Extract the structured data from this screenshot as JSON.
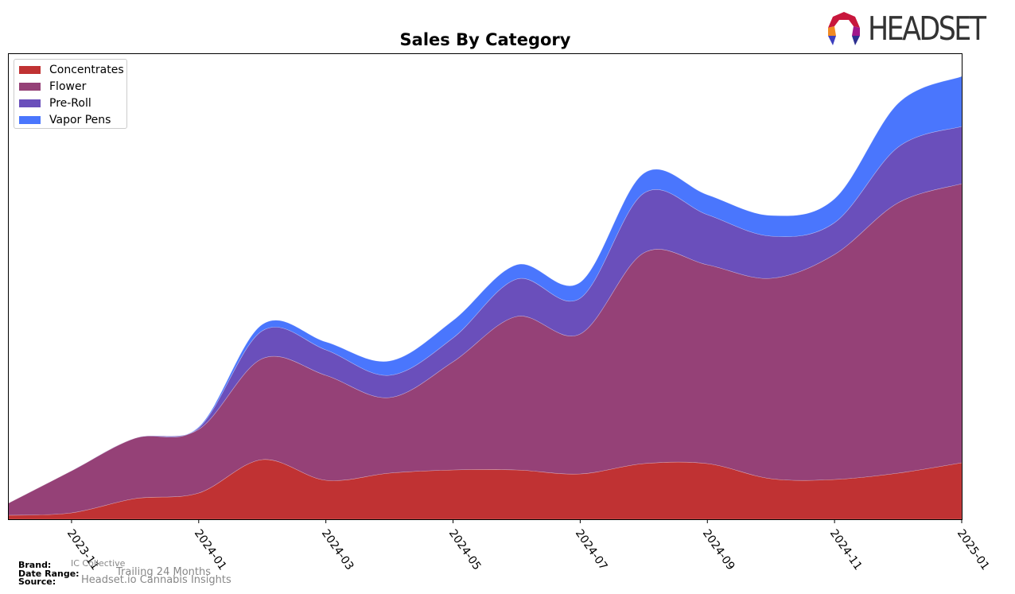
{
  "logo": {
    "text": "HEADSET",
    "icon": "headset-logo-icon"
  },
  "chart_data": {
    "type": "area",
    "stacked": true,
    "smoothed": true,
    "title": "Sales By Category",
    "xlabel": "",
    "ylabel": "",
    "y_units": "relative (no y-axis labels shown)",
    "x": [
      "2023-10",
      "2023-11",
      "2023-12",
      "2024-01",
      "2024-02",
      "2024-03",
      "2024-04",
      "2024-05",
      "2024-06",
      "2024-07",
      "2024-08",
      "2024-09",
      "2024-10",
      "2024-11",
      "2024-12",
      "2025-01"
    ],
    "x_tick_labels": [
      "2023-11",
      "2024-01",
      "2024-03",
      "2024-05",
      "2024-07",
      "2024-09",
      "2024-11",
      "2025-01"
    ],
    "ylim": [
      0,
      586
    ],
    "grid": false,
    "legend_position": "top-left",
    "series": [
      {
        "name": "Concentrates",
        "color": "#c03233",
        "values": [
          5,
          8,
          26,
          33,
          75,
          49,
          58,
          62,
          62,
          57,
          70,
          70,
          51,
          50,
          58,
          71
        ]
      },
      {
        "name": "Flower",
        "color": "#954177",
        "values": [
          15,
          53,
          76,
          80,
          127,
          132,
          95,
          136,
          193,
          176,
          265,
          250,
          252,
          283,
          340,
          351
        ]
      },
      {
        "name": "Pre-Roll",
        "color": "#6a4fbb",
        "values": [
          0,
          0,
          0,
          2,
          35,
          32,
          28,
          30,
          47,
          45,
          75,
          63,
          53,
          40,
          70,
          72
        ]
      },
      {
        "name": "Vapor Pens",
        "color": "#4a76fd",
        "values": [
          0,
          0,
          0,
          1,
          8,
          10,
          18,
          22,
          18,
          20,
          25,
          25,
          26,
          30,
          55,
          63
        ]
      }
    ]
  },
  "footer": {
    "brand_label": "Brand:",
    "brand_value": "IC Collective",
    "date_range_label": "Date Range:",
    "date_range_value": "Trailing 24 Months",
    "source_label": "Source:",
    "source_value": "Headset.io Cannabis Insights"
  }
}
